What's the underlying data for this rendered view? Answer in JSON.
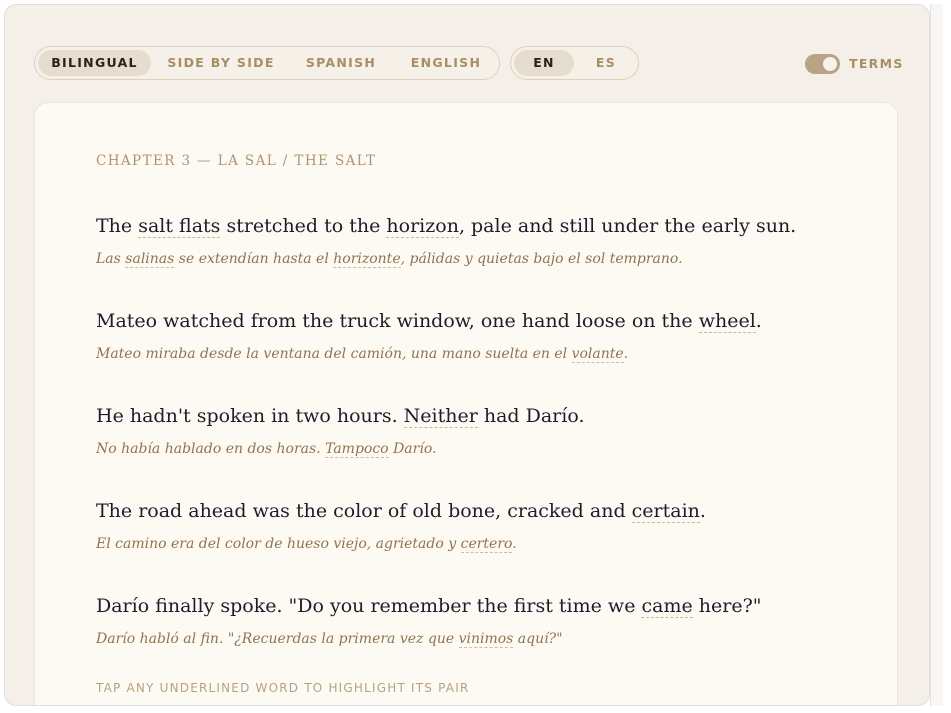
{
  "modes": [
    {
      "label": "BILINGUAL",
      "active": true
    },
    {
      "label": "SIDE BY SIDE",
      "active": false
    },
    {
      "label": "SPANISH",
      "active": false
    },
    {
      "label": "ENGLISH",
      "active": false
    }
  ],
  "languages": [
    {
      "label": "EN",
      "active": true
    },
    {
      "label": "ES",
      "active": false
    }
  ],
  "terms_toggle": {
    "label": "TERMS",
    "on": true,
    "icon": "toggle-switch"
  },
  "chapter_heading": "CHAPTER 3 — LA SAL / THE SALT",
  "lines": [
    {
      "en": {
        "a": "The ",
        "t1": "salt flats",
        "b": " stretched to the ",
        "t2": "horizon",
        "c": ", pale and still under the early sun."
      },
      "es": {
        "a": "Las ",
        "t1": "salinas",
        "b": " se extendían hasta el ",
        "t2": "horizonte",
        "c": ", pálidas y quietas bajo el sol temprano."
      }
    },
    {
      "en": {
        "a": "Mateo watched from the truck window, one hand loose on the ",
        "t1": "wheel",
        "b": "."
      },
      "es": {
        "a": "Mateo miraba desde la ventana del camión, una mano suelta en el ",
        "t1": "volante",
        "b": "."
      }
    },
    {
      "en": {
        "a": "He hadn't spoken in two hours. ",
        "t1": "Neither",
        "b": " had Darío."
      },
      "es": {
        "a": "No había hablado en dos horas. ",
        "t1": "Tampoco",
        "b": " Darío."
      }
    },
    {
      "en": {
        "a": "The road ahead was the color of old bone, cracked and ",
        "t1": "certain",
        "b": "."
      },
      "es": {
        "a": "El camino era del color de hueso viejo, agrietado y ",
        "t1": "certero",
        "b": "."
      }
    },
    {
      "en": {
        "a": "Darío finally spoke. \"Do you remember the first time we ",
        "t1": "came",
        "b": " here?\""
      },
      "es": {
        "a": "Darío habló al fin. \"¿Recuerdas la primera vez que ",
        "t1": "vinimos",
        "b": " aquí?\""
      }
    }
  ],
  "hint": "TAP ANY UNDERLINED WORD TO HIGHLIGHT ITS PAIR",
  "colors": {
    "background": "#f4efe8",
    "card": "#fdfaf4",
    "accent": "#a88e66",
    "text": "#1f1b2a",
    "translation": "#8f7450"
  }
}
